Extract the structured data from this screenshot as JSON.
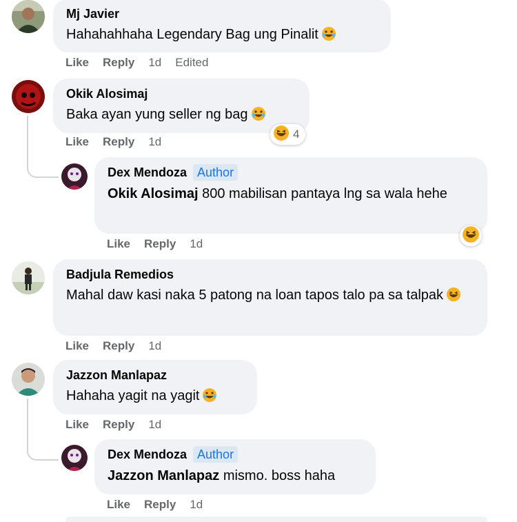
{
  "actions": {
    "like": "Like",
    "reply": "Reply"
  },
  "comments": [
    {
      "author": "Mj Javier",
      "text": "Hahahahhaha Legendary Bag ung Pinalit",
      "time": "1d",
      "edited": "Edited"
    },
    {
      "author": "Okik Alosimaj",
      "text": "Baka ayan yung seller ng bag",
      "time": "1d",
      "reaction_count": "4"
    },
    {
      "author": "Dex Mendoza",
      "badge": "Author",
      "mention": "Okik Alosimaj",
      "text": "800 mabilisan pantaya lng sa wala hehe",
      "time": "1d"
    },
    {
      "author": "Badjula Remedios",
      "text": "Mahal daw kasi naka 5 patong na loan tapos talo pa sa talpak",
      "time": "1d"
    },
    {
      "author": "Jazzon Manlapaz",
      "text": "Hahaha yagit na yagit",
      "time": "1d"
    },
    {
      "author": "Dex Mendoza",
      "badge": "Author",
      "mention": "Jazzon Manlapaz",
      "text": "mismo. boss haha",
      "time": "1d"
    }
  ],
  "icons": {
    "laugh": "rolling-on-floor-laughing-emoji",
    "haha": "haha-reaction-emoji"
  },
  "colors": {
    "bubble": "#f0f2f5",
    "author_badge_bg": "#dbe7f2",
    "author_badge_text": "#1b74e4",
    "meta_text": "#65676b"
  }
}
